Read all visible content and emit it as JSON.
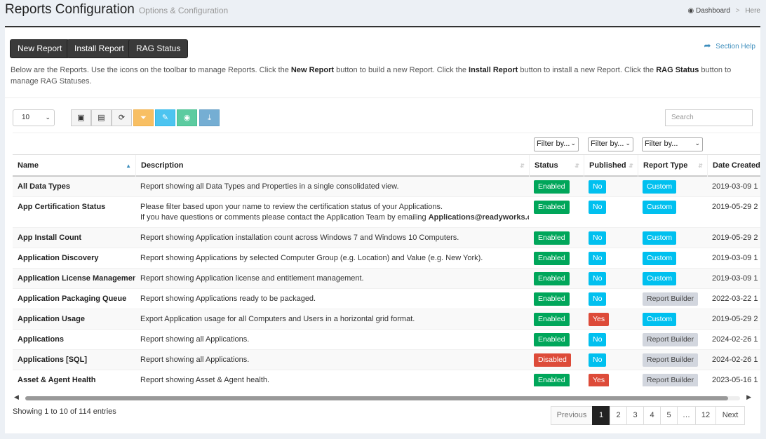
{
  "header": {
    "title": "Reports Configuration",
    "subtitle": "Options & Configuration",
    "breadcrumb": {
      "home": "Dashboard",
      "separator": ">",
      "current": "Here"
    }
  },
  "toolbar": {
    "new_report": "New Report",
    "install_report": "Install Report",
    "rag_status": "RAG Status",
    "section_help": "Section Help"
  },
  "intro": {
    "p1": "Below are the Reports. Use the icons on the toolbar to manage Reports. Click the ",
    "b1": "New Report",
    "p2": " button to build a new Report. Click the ",
    "b2": "Install Report",
    "p3": " button to install a new Report. Click the ",
    "b3": "RAG Status",
    "p4": " button to manage RAG Statuses."
  },
  "grid_toolbar": {
    "page_length": "10",
    "search_placeholder": "Search"
  },
  "filters": {
    "status": "Filter by...",
    "published": "Filter by...",
    "report_type": "Filter by..."
  },
  "columns": {
    "name": "Name",
    "description": "Description",
    "status": "Status",
    "published": "Published",
    "report_type": "Report Type",
    "date_created": "Date Created"
  },
  "rows": [
    {
      "name": "All Data Types",
      "desc": "Report showing all Data Types and Properties in a single consolidated view.",
      "status": "Enabled",
      "published": "No",
      "type": "Custom",
      "date": "2019-03-09 1"
    },
    {
      "name": "App Certification Status",
      "desc": "Please filter based upon your name to review the certification status of your Applications.",
      "desc2a": "If you have questions or comments please contact the Application Team by emailing ",
      "desc2b": "Applications@readyworks.com",
      "desc2c": ".",
      "status": "Enabled",
      "published": "No",
      "type": "Custom",
      "date": "2019-05-29 2"
    },
    {
      "name": "App Install Count",
      "desc": "Report showing Application installation count across Windows 7 and Windows 10 Computers.",
      "status": "Enabled",
      "published": "No",
      "type": "Custom",
      "date": "2019-05-29 2"
    },
    {
      "name": "Application Discovery",
      "desc": "Report showing Applications by selected Computer Group (e.g. Location) and Value (e.g. New York).",
      "status": "Enabled",
      "published": "No",
      "type": "Custom",
      "date": "2019-03-09 1"
    },
    {
      "name": "Application License Management",
      "desc": "Report showing Application license and entitlement management.",
      "status": "Enabled",
      "published": "No",
      "type": "Custom",
      "date": "2019-03-09 1"
    },
    {
      "name": "Application Packaging Queue",
      "desc": "Report showing Applications ready to be packaged.",
      "status": "Enabled",
      "published": "No",
      "type": "Report Builder",
      "date": "2022-03-22 1"
    },
    {
      "name": "Application Usage",
      "desc": "Export Application usage for all Computers and Users in a horizontal grid format.",
      "status": "Enabled",
      "published": "Yes",
      "type": "Custom",
      "date": "2019-05-29 2"
    },
    {
      "name": "Applications",
      "desc": "Report showing all Applications.",
      "status": "Enabled",
      "published": "No",
      "type": "Report Builder",
      "date": "2024-02-26 1"
    },
    {
      "name": "Applications [SQL]",
      "desc": "Report showing all Applications.",
      "status": "Disabled",
      "published": "No",
      "type": "Report Builder",
      "date": "2024-02-26 1"
    },
    {
      "name": "Asset & Agent Health",
      "desc": "Report showing Asset & Agent health.",
      "status": "Enabled",
      "published": "Yes",
      "type": "Report Builder",
      "date": "2023-05-16 1"
    }
  ],
  "footer": {
    "info": "Showing 1 to 10 of 114 entries",
    "pager": [
      "Previous",
      "1",
      "2",
      "3",
      "4",
      "5",
      "…",
      "12",
      "Next"
    ],
    "active_page": "1"
  }
}
